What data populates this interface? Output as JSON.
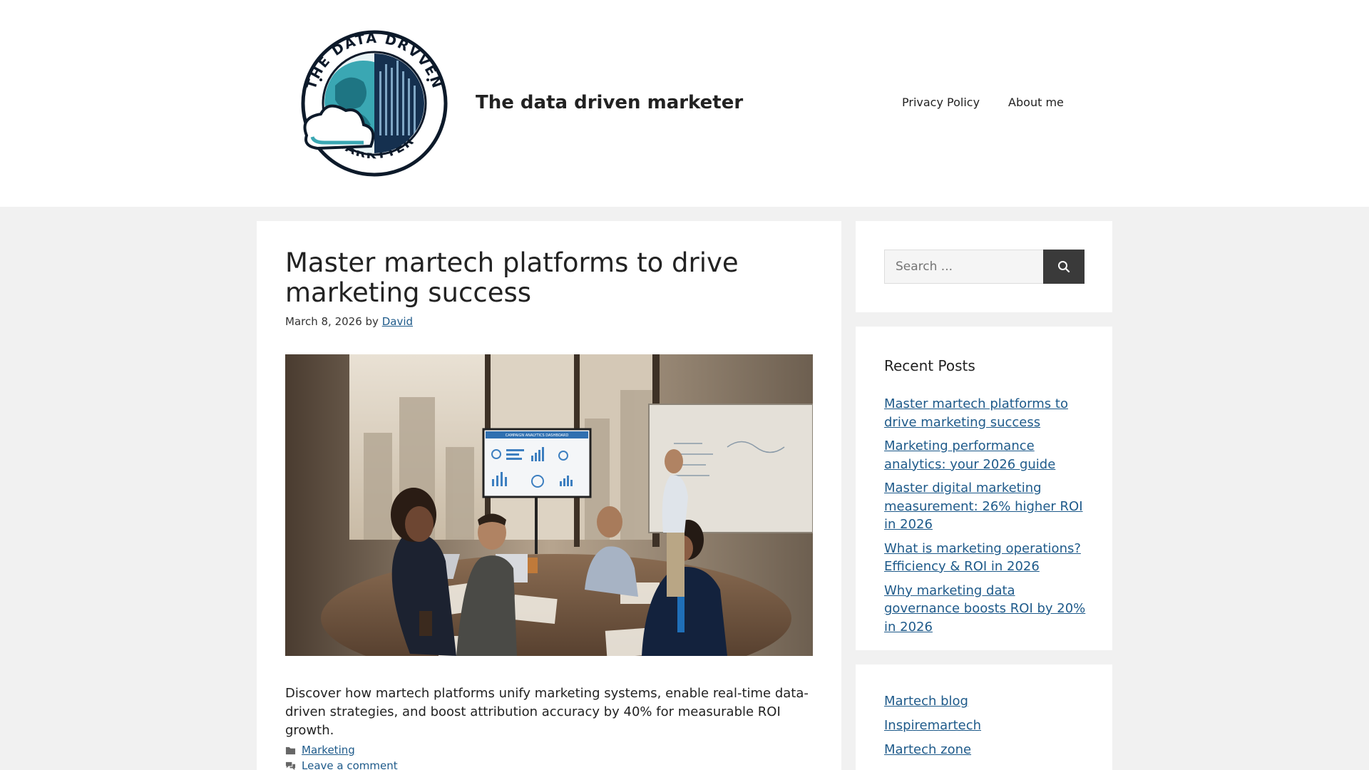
{
  "site": {
    "title": "The data driven marketer",
    "logo_text_top": "THE DATA DRVVEN",
    "logo_text_bottom": "MARKTTER"
  },
  "nav": {
    "items": [
      {
        "label": "Privacy Policy"
      },
      {
        "label": "About me"
      }
    ]
  },
  "post": {
    "title": "Master martech platforms to drive marketing success",
    "date": "March 8, 2026",
    "by": "by",
    "author": "David",
    "image_screen_title": "CAMPAIGN ANALYTICS DASHBOARD",
    "excerpt": "Discover how martech platforms unify marketing systems, enable real-time data-driven strategies, and boost attribution accuracy by 40% for measurable ROI growth.",
    "category": "Marketing",
    "comment_link": "Leave a comment"
  },
  "sidebar": {
    "search_placeholder": "Search ...",
    "recent_title": "Recent Posts",
    "recent_posts": [
      {
        "label": "Master martech platforms to drive marketing success"
      },
      {
        "label": "Marketing performance analytics: your 2026 guide"
      },
      {
        "label": "Master digital marketing measurement: 26% higher ROI in 2026"
      },
      {
        "label": "What is marketing operations? Efficiency & ROI in 2026"
      },
      {
        "label": "Why marketing data governance boosts ROI by 20% in 2026"
      }
    ],
    "links": [
      {
        "label": "Martech blog"
      },
      {
        "label": "Inspiremartech"
      },
      {
        "label": "Martech zone"
      }
    ]
  },
  "colors": {
    "link": "#1e5a8a",
    "background": "#f1f1f1",
    "search_button": "#3a3a3a",
    "logo_teal": "#3aa7b3",
    "logo_navy": "#15304f"
  }
}
